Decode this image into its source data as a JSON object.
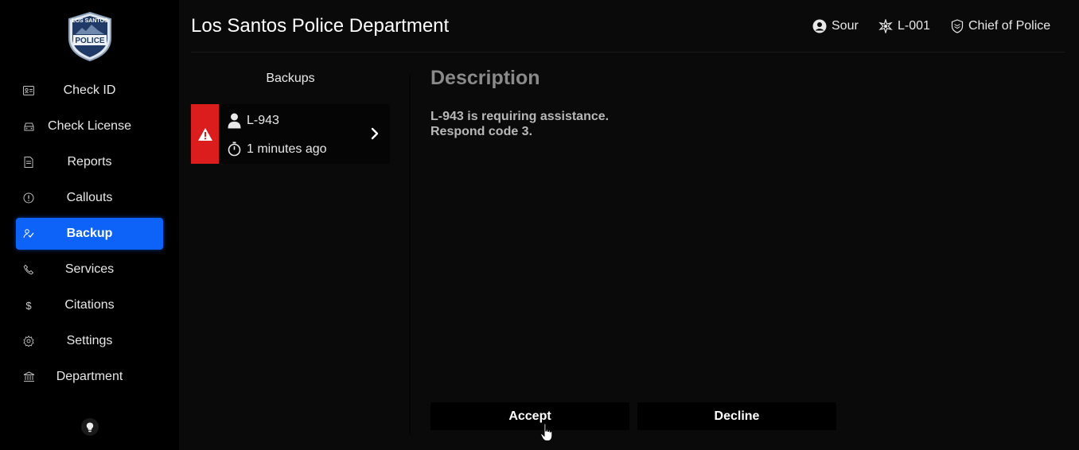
{
  "app": {
    "title": "Los Santos Police Department",
    "logo_text_top": "LOS SANTOS",
    "logo_text_main": "POLICE"
  },
  "header": {
    "user_name": "Sour",
    "unit_id": "L-001",
    "rank": "Chief of Police"
  },
  "sidebar": {
    "items": [
      {
        "label": "Check ID",
        "icon": "id-card-icon"
      },
      {
        "label": "Check License",
        "icon": "car-icon"
      },
      {
        "label": "Reports",
        "icon": "file-icon"
      },
      {
        "label": "Callouts",
        "icon": "alert-circle-icon"
      },
      {
        "label": "Backup",
        "icon": "backup-icon",
        "active": true
      },
      {
        "label": "Services",
        "icon": "phone-icon"
      },
      {
        "label": "Citations",
        "icon": "dollar-icon"
      },
      {
        "label": "Settings",
        "icon": "gear-icon"
      },
      {
        "label": "Department",
        "icon": "bank-icon"
      }
    ]
  },
  "backups": {
    "title": "Backups",
    "items": [
      {
        "unit": "L-943",
        "time": "1 minutes ago"
      }
    ]
  },
  "description": {
    "title": "Description",
    "line1": "L-943 is requiring assistance.",
    "line2": "Respond code 3."
  },
  "actions": {
    "accept": "Accept",
    "decline": "Decline"
  },
  "colors": {
    "accent": "#0d63f8",
    "alert": "#dc1d1d",
    "background": "#0a0a0a",
    "sidebar": "#000000"
  }
}
